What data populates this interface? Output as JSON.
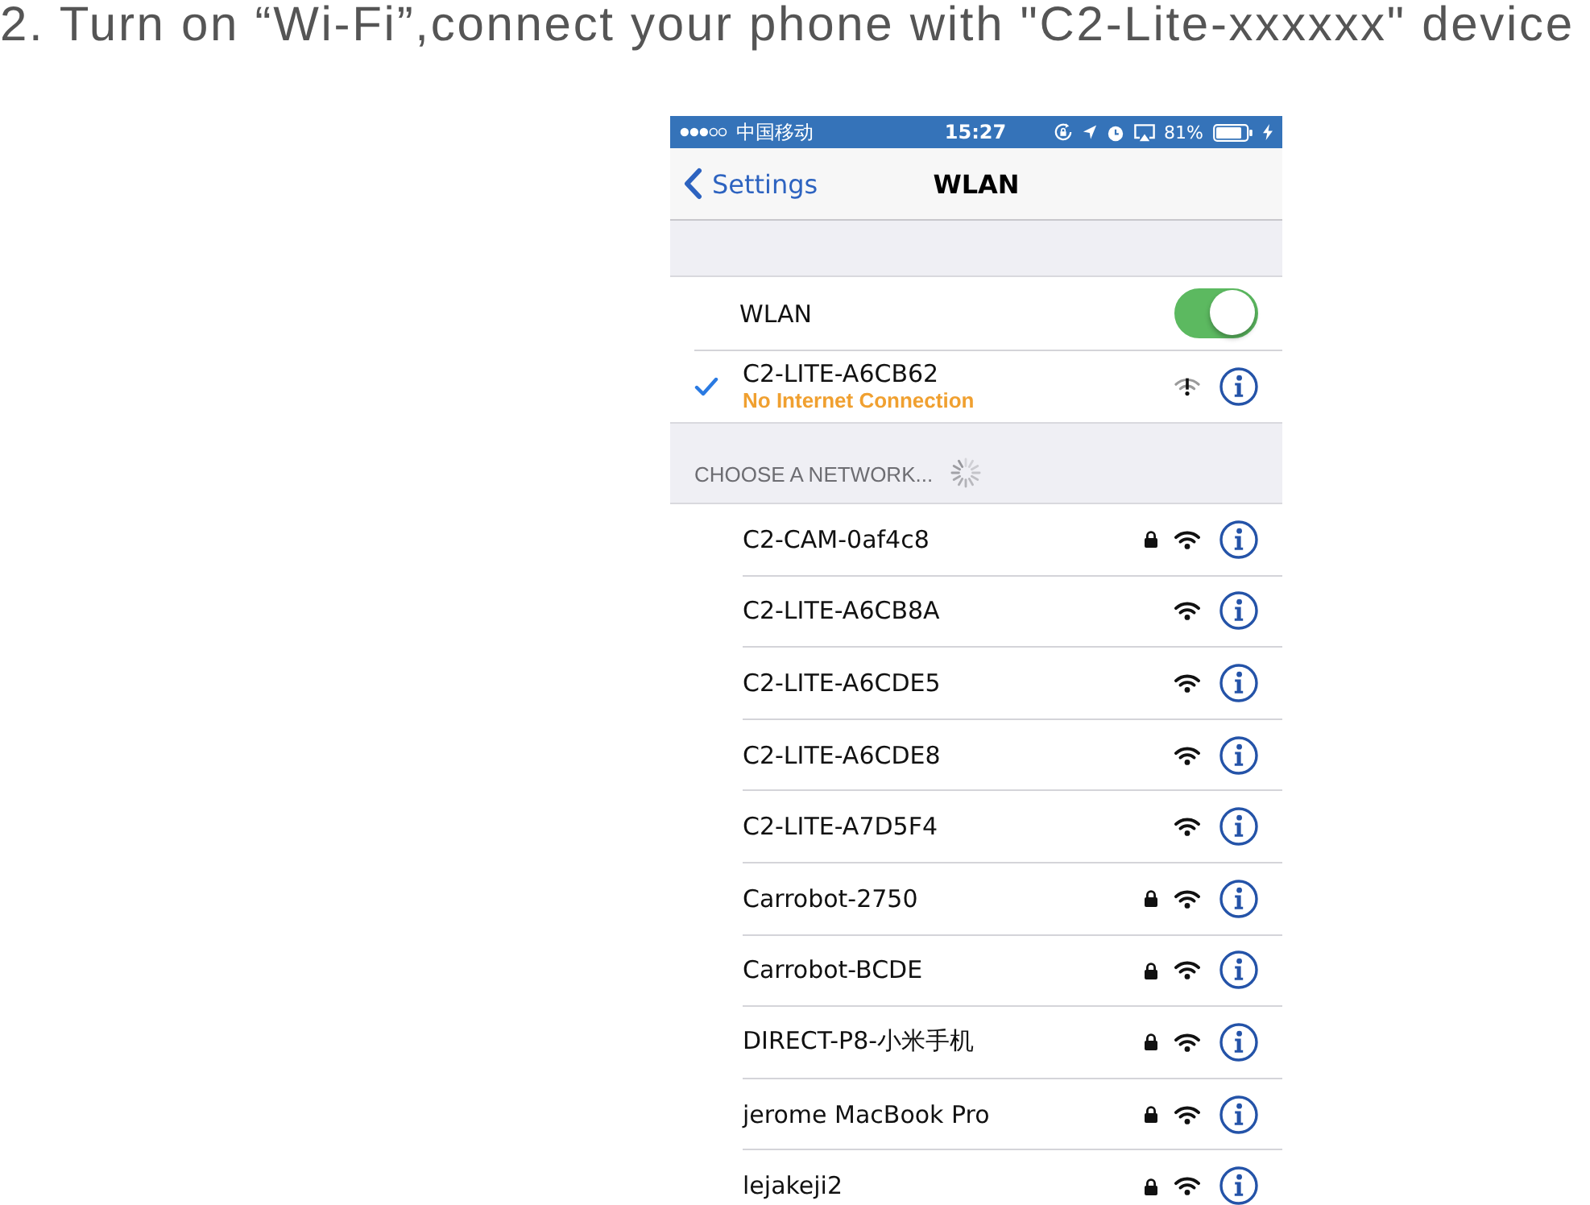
{
  "instruction": {
    "text": "2. Turn on “Wi-Fi”,connect your phone with \"C2-Lite-xxxxxx\" device"
  },
  "phone": {
    "status_bar": {
      "carrier": "中国移动",
      "time": "15:27",
      "battery": "81%"
    },
    "nav_bar": {
      "back": "Settings",
      "title": "WLAN"
    },
    "wlan_switch": {
      "label": "WLAN",
      "on": true
    },
    "connected_network": {
      "name": "C2-LITE-A6CB62",
      "status": "No Internet Connection",
      "connected": true
    },
    "section_header": "CHOOSE A NETWORK...",
    "networks": [
      {
        "name": "C2-CAM-0af4c8",
        "locked": true
      },
      {
        "name": "C2-LITE-A6CB8A",
        "locked": false
      },
      {
        "name": "C2-LITE-A6CDE5",
        "locked": false
      },
      {
        "name": "C2-LITE-A6CDE8",
        "locked": false
      },
      {
        "name": "C2-LITE-A7D5F4",
        "locked": false
      },
      {
        "name": "Carrobot-2750",
        "locked": true
      },
      {
        "name": "Carrobot-BCDE",
        "locked": true
      },
      {
        "name": "DIRECT-P8-小米手机",
        "locked": true
      },
      {
        "name": "jerome MacBook Pro",
        "locked": true
      },
      {
        "name": "lejakeji2",
        "locked": true
      }
    ]
  }
}
